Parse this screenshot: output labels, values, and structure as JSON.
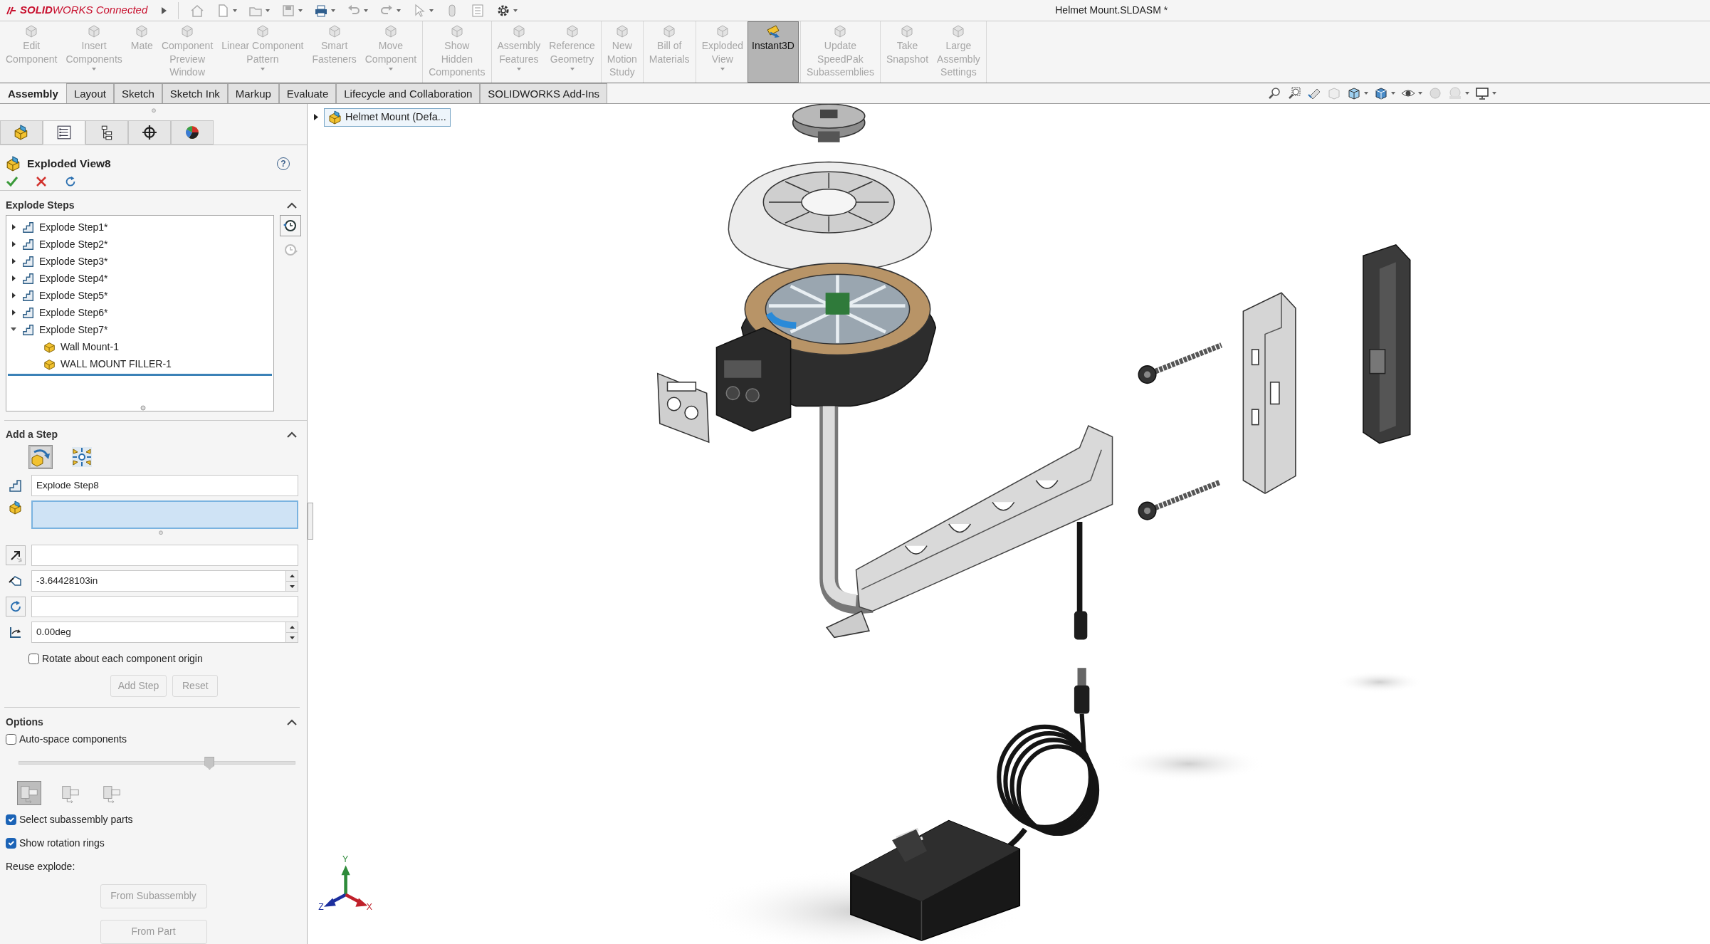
{
  "title_bar": {
    "brand": "**SOLID**WORKS Connected",
    "document_title": "Helmet Mount.SLDASM *"
  },
  "command_groups": [
    [
      {
        "label": "Edit\nComponent",
        "disabled": true,
        "dropdown": false,
        "selected": false
      },
      {
        "label": "Insert\nComponents",
        "disabled": true,
        "dropdown": true,
        "selected": false
      },
      {
        "label": "Mate",
        "disabled": true,
        "dropdown": false,
        "selected": false
      },
      {
        "label": "Component\nPreview\nWindow",
        "disabled": true,
        "dropdown": false,
        "selected": false
      },
      {
        "label": "Linear Component\nPattern",
        "disabled": true,
        "dropdown": true,
        "selected": false
      },
      {
        "label": "Smart\nFasteners",
        "disabled": true,
        "dropdown": false,
        "selected": false
      },
      {
        "label": "Move\nComponent",
        "disabled": true,
        "dropdown": true,
        "selected": false
      }
    ],
    [
      {
        "label": "Show\nHidden\nComponents",
        "disabled": true,
        "dropdown": false,
        "selected": false
      }
    ],
    [
      {
        "label": "Assembly\nFeatures",
        "disabled": true,
        "dropdown": true,
        "selected": false
      },
      {
        "label": "Reference\nGeometry",
        "disabled": true,
        "dropdown": true,
        "selected": false
      }
    ],
    [
      {
        "label": "New\nMotion\nStudy",
        "disabled": true,
        "dropdown": false,
        "selected": false
      }
    ],
    [
      {
        "label": "Bill of\nMaterials",
        "disabled": true,
        "dropdown": false,
        "selected": false
      }
    ],
    [
      {
        "label": "Exploded\nView",
        "disabled": true,
        "dropdown": true,
        "selected": false
      },
      {
        "label": "Instant3D",
        "disabled": false,
        "dropdown": false,
        "selected": true
      }
    ],
    [
      {
        "label": "Update\nSpeedPak\nSubassemblies",
        "disabled": true,
        "dropdown": false,
        "selected": false
      }
    ],
    [
      {
        "label": "Take\nSnapshot",
        "disabled": true,
        "dropdown": false,
        "selected": false
      },
      {
        "label": "Large\nAssembly\nSettings",
        "disabled": true,
        "dropdown": false,
        "selected": false
      }
    ]
  ],
  "tabs": [
    {
      "label": "Assembly",
      "selected": true
    },
    {
      "label": "Layout",
      "selected": false
    },
    {
      "label": "Sketch",
      "selected": false
    },
    {
      "label": "Sketch Ink",
      "selected": false
    },
    {
      "label": "Markup",
      "selected": false
    },
    {
      "label": "Evaluate",
      "selected": false
    },
    {
      "label": "Lifecycle and Collaboration",
      "selected": false
    },
    {
      "label": "SOLIDWORKS Add-Ins",
      "selected": false
    }
  ],
  "panel_tabs": [
    {
      "kind": "feature-tree",
      "selected": false
    },
    {
      "kind": "property-manager",
      "selected": true
    },
    {
      "kind": "configuration",
      "selected": false
    },
    {
      "kind": "dimxpert",
      "selected": false
    },
    {
      "kind": "display",
      "selected": false
    }
  ],
  "property_manager": {
    "title": "Exploded View8",
    "help": "?"
  },
  "explode_steps": {
    "title": "Explode Steps",
    "expanded": true,
    "items": [
      {
        "label": "Explode Step1*",
        "expanded": false
      },
      {
        "label": "Explode Step2*",
        "expanded": false
      },
      {
        "label": "Explode Step3*",
        "expanded": false
      },
      {
        "label": "Explode Step4*",
        "expanded": false
      },
      {
        "label": "Explode Step5*",
        "expanded": false
      },
      {
        "label": "Explode Step6*",
        "expanded": false
      },
      {
        "label": "Explode Step7*",
        "expanded": true,
        "children": [
          {
            "label": "Wall Mount-1"
          },
          {
            "label": "WALL MOUNT FILLER-1"
          }
        ]
      }
    ]
  },
  "add_step": {
    "title": "Add a Step",
    "expanded": true,
    "modes": [
      {
        "kind": "regular",
        "selected": true
      },
      {
        "kind": "radial",
        "selected": false
      }
    ],
    "fields": [
      {
        "kind": "name",
        "value": "Explode Step8"
      },
      {
        "kind": "components",
        "active": true
      },
      {
        "kind": "direction",
        "active": false
      },
      {
        "kind": "distance",
        "value": "-3.64428103in"
      },
      {
        "kind": "axis",
        "active": false
      },
      {
        "kind": "angle",
        "value": "0.00deg"
      }
    ],
    "rotate_checkbox": {
      "label": "Rotate about each component origin",
      "checked": false
    },
    "buttons": [
      {
        "label": "Add Step",
        "disabled": true
      },
      {
        "label": "Reset",
        "disabled": true
      }
    ]
  },
  "options": {
    "title": "Options",
    "expanded": true,
    "auto_space": {
      "label": "Auto-space components",
      "checked": false
    },
    "slider": {
      "level": 0.69
    },
    "chain_modes": [
      {
        "selected": true
      },
      {
        "selected": false
      },
      {
        "selected": false
      }
    ],
    "checkboxes": [
      {
        "label": "Select subassembly parts",
        "checked": true
      },
      {
        "label": "Show rotation rings",
        "checked": true
      }
    ],
    "reuse_label": "Reuse explode:",
    "buttons": [
      {
        "label": "From Subassembly",
        "disabled": true
      },
      {
        "label": "From Part",
        "disabled": true
      }
    ]
  },
  "flyout_tree": {
    "label": "Helmet Mount (Defa..."
  },
  "triad": {
    "y": "Y",
    "z": "Z",
    "x": "X"
  }
}
